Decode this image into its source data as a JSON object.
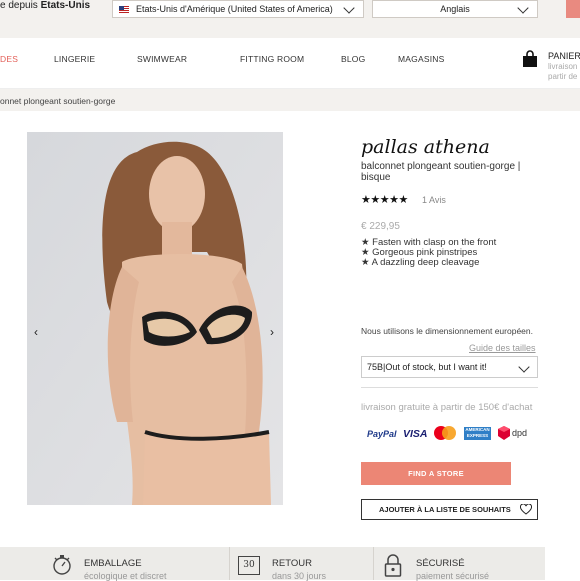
{
  "topbar": {
    "visit_prefix": "e depuis",
    "visit_country": "Etats-Unis",
    "country_select": "Etats-Unis d'Amérique (United States of America)",
    "language_select": "Anglais"
  },
  "nav": {
    "soldes": "DES",
    "lingerie": "LINGERIE",
    "swimwear": "SWIMWEAR",
    "fitting_room": "FITTING ROOM",
    "blog": "BLOG",
    "magasins": "MAGASINS",
    "cart_title": "PANIER",
    "cart_sub_1": "livraison",
    "cart_sub_2": "partir de"
  },
  "breadcrumb": "onnet plongeant soutien-gorge",
  "product": {
    "brand": "pallas athena",
    "subtitle": "balconnet plongeant soutien-gorge | bisque",
    "stars": "★★★★★",
    "rating": 5,
    "reviews": "1 Avis",
    "price": "€ 229,95",
    "features": [
      "★ Fasten with clasp on the front",
      "★ Gorgeous pink pinstripes",
      "★ A dazzling deep cleavage"
    ],
    "sizing_note": "Nous utilisons le dimensionnement européen.",
    "size_guide": "Guide des tailles",
    "size_selected": "75B|Out of stock, but I want it!",
    "shipping": "livraison gratuite à partir de 150€ d'achat",
    "find_store": "FIND A STORE",
    "wishlist": "AJOUTER À LA LISTE DE SOUHAITS"
  },
  "payments": {
    "paypal": "PayPal",
    "visa": "VISA",
    "amex_line1": "AMERICAN",
    "amex_line2": "EXPRESS",
    "dpd": "dpd"
  },
  "features_bar": [
    {
      "title": "EMBALLAGE",
      "sub": "écologique et discret",
      "icon": "stopwatch-icon"
    },
    {
      "title": "RETOUR",
      "sub": "dans 30 jours",
      "icon_text": "30",
      "icon": "calendar-icon"
    },
    {
      "title": "SÉCURISÉ",
      "sub": "paiement sécurisé",
      "icon": "lock-icon"
    }
  ],
  "colors": {
    "accent": "#ec8675",
    "sale": "#e3615a",
    "topbar_bg": "#f3f1ee"
  }
}
